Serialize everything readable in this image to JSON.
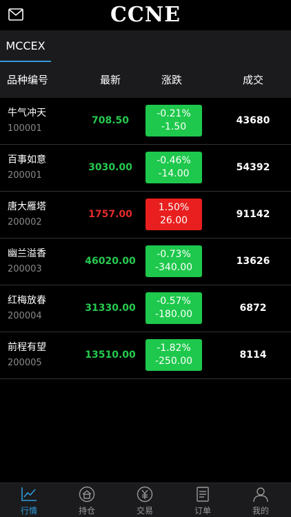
{
  "header": {
    "logo": "CCNE",
    "mail_icon": "mail-icon"
  },
  "market_tab": {
    "label": "MCCEX"
  },
  "columns": {
    "name": "品种编号",
    "latest": "最新",
    "change": "涨跌",
    "volume": "成交"
  },
  "colors": {
    "up": "#e91e1e",
    "down": "#1ec84c",
    "accent": "#2f9bdc"
  },
  "rows": [
    {
      "name": "牛气冲天",
      "code": "100001",
      "price": "708.50",
      "pct": "-0.21%",
      "amt": "-1.50",
      "volume": "43680",
      "trend": "down"
    },
    {
      "name": "百事如意",
      "code": "200001",
      "price": "3030.00",
      "pct": "-0.46%",
      "amt": "-14.00",
      "volume": "54392",
      "trend": "down"
    },
    {
      "name": "唐大雁塔",
      "code": "200002",
      "price": "1757.00",
      "pct": "1.50%",
      "amt": "26.00",
      "volume": "91142",
      "trend": "up"
    },
    {
      "name": "幽兰溢香",
      "code": "200003",
      "price": "46020.00",
      "pct": "-0.73%",
      "amt": "-340.00",
      "volume": "13626",
      "trend": "down"
    },
    {
      "name": "红梅放春",
      "code": "200004",
      "price": "31330.00",
      "pct": "-0.57%",
      "amt": "-180.00",
      "volume": "6872",
      "trend": "down"
    },
    {
      "name": "前程有望",
      "code": "200005",
      "price": "13510.00",
      "pct": "-1.82%",
      "amt": "-250.00",
      "volume": "8114",
      "trend": "down"
    }
  ],
  "nav": [
    {
      "label": "行情",
      "icon": "chart-icon",
      "active": true
    },
    {
      "label": "持仓",
      "icon": "home-icon",
      "active": false
    },
    {
      "label": "交易",
      "icon": "yen-icon",
      "active": false
    },
    {
      "label": "订单",
      "icon": "document-icon",
      "active": false
    },
    {
      "label": "我的",
      "icon": "user-icon",
      "active": false
    }
  ]
}
